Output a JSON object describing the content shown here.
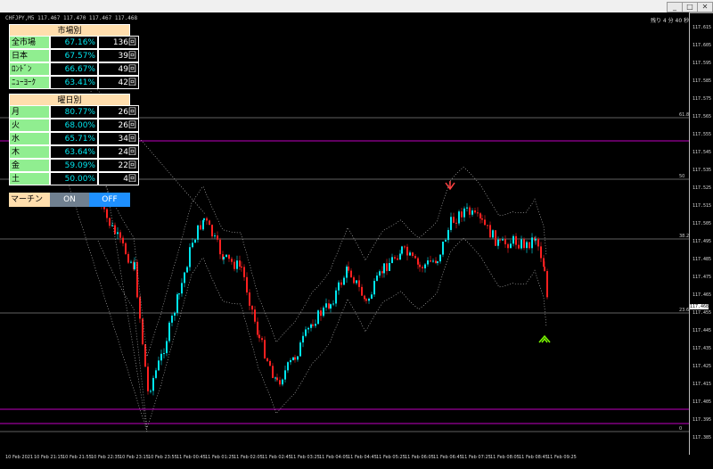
{
  "window": {
    "symbol": "CHFJPY,M5 117.467 117.470 117.467 117.468",
    "timer": "残り 4 分 40 秒"
  },
  "panel": {
    "market_header": "市場別",
    "market_rows": [
      {
        "label": "全市場",
        "pct": "67.16%",
        "count": "136回"
      },
      {
        "label": "日本",
        "pct": "67.57%",
        "count": "39回"
      },
      {
        "label": "ﾛﾝﾄﾞﾝ",
        "pct": "66.67%",
        "count": "49回"
      },
      {
        "label": "ﾆｭｰﾖｰｸ",
        "pct": "63.41%",
        "count": "42回"
      }
    ],
    "day_header": "曜日別",
    "day_rows": [
      {
        "label": "月",
        "pct": "80.77%",
        "count": "26回"
      },
      {
        "label": "火",
        "pct": "68.00%",
        "count": "26回"
      },
      {
        "label": "水",
        "pct": "65.71%",
        "count": "34回"
      },
      {
        "label": "木",
        "pct": "63.64%",
        "count": "24回"
      },
      {
        "label": "金",
        "pct": "59.09%",
        "count": "22回"
      },
      {
        "label": "土",
        "pct": "50.00%",
        "count": "4回"
      }
    ],
    "martin_label": "マーチン",
    "on_label": "ON",
    "off_label": "OFF"
  },
  "price_axis": [
    "117.615",
    "117.605",
    "117.595",
    "117.585",
    "117.575",
    "117.565",
    "117.555",
    "117.545",
    "117.535",
    "117.525",
    "117.515",
    "117.505",
    "117.495",
    "117.485",
    "117.475",
    "117.465",
    "117.455",
    "117.445",
    "117.435",
    "117.425",
    "117.415",
    "117.405",
    "117.395",
    "117.385"
  ],
  "current_price": "117.468",
  "fib_labels": [
    "61.8",
    "50",
    "38.2",
    "23.6",
    "0"
  ],
  "time_axis": [
    "10 Feb 2021",
    "10 Feb 21:15",
    "10 Feb 21:55",
    "10 Feb 22:35",
    "10 Feb 23:15",
    "10 Feb 23:55",
    "11 Feb 00:45",
    "11 Feb 01:25",
    "11 Feb 02:05",
    "11 Feb 02:45",
    "11 Feb 03:25",
    "11 Feb 04:05",
    "11 Feb 04:45",
    "11 Feb 05:25",
    "11 Feb 06:05",
    "11 Feb 06:45",
    "11 Feb 07:25",
    "11 Feb 08:05",
    "11 Feb 08:45",
    "11 Feb 09:25"
  ],
  "colors": {
    "bull": "#00e5ee",
    "bear": "#ff2020",
    "fib": "#c0c0c0",
    "magenta": "#ff00ff",
    "band": "#cccccc"
  }
}
